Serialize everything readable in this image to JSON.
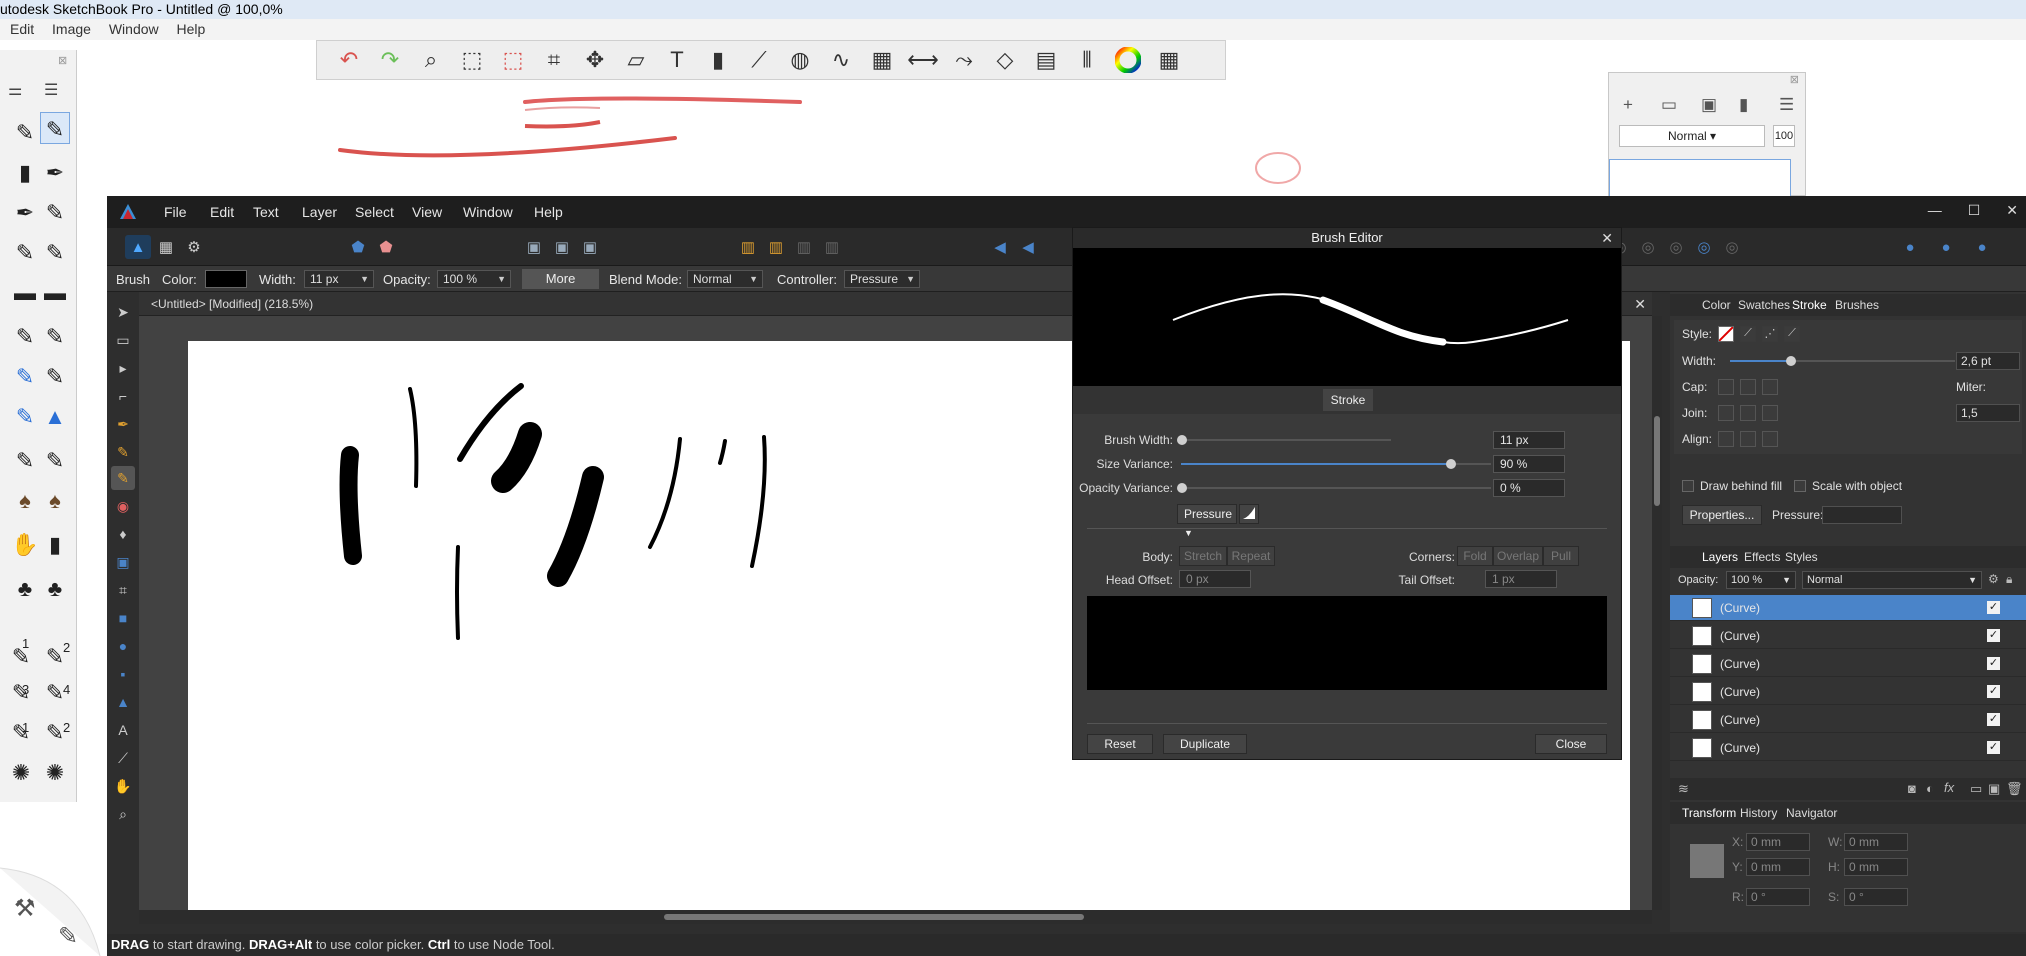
{
  "sketchbook": {
    "title": "utodesk SketchBook Pro - Untitled @ 100,0%",
    "menu": [
      "Edit",
      "Image",
      "Window",
      "Help"
    ],
    "toolbar_icons": [
      "undo-icon",
      "redo-icon",
      "zoom-icon",
      "select-icon",
      "lasso-icon",
      "crop-icon",
      "move-icon",
      "distort-icon",
      "text-icon",
      "bucket-icon",
      "ruler-icon",
      "ellipse-guide-icon",
      "curve-guide-icon",
      "perspective-icon",
      "symmetry-icon",
      "stroke-icon",
      "shapes-icon",
      "copic-icon",
      "brush-palette-icon",
      "color-wheel-icon",
      "palette-icon"
    ],
    "brush_numbers": [
      "1",
      "2",
      "3",
      "4",
      "1",
      "2"
    ],
    "layers": {
      "blend": "Normal",
      "opacity": "100"
    }
  },
  "affinity": {
    "menu": [
      "File",
      "Edit",
      "Text",
      "Layer",
      "Select",
      "View",
      "Window",
      "Help"
    ],
    "context_bar": {
      "tool": "Brush",
      "color_label": "Color:",
      "width_label": "Width:",
      "width_value": "11 px",
      "opacity_label": "Opacity:",
      "opacity_value": "100 %",
      "more_label": "More",
      "blend_label": "Blend Mode:",
      "blend_value": "Normal",
      "controller_label": "Controller:",
      "controller_value": "Pressure"
    },
    "document_tab": "<Untitled> [Modified] (218.5%)",
    "status": {
      "k1": "DRAG",
      "t1": " to start drawing. ",
      "k2": "DRAG+Alt",
      "t2": " to use color picker. ",
      "k3": "Ctrl",
      "t3": " to use Node Tool."
    },
    "stroke_panel": {
      "tabs": [
        "Color",
        "Swatches",
        "Stroke",
        "Brushes"
      ],
      "style_label": "Style:",
      "width_label": "Width:",
      "width_value": "2,6 pt",
      "cap_label": "Cap:",
      "join_label": "Join:",
      "miter_label": "Miter:",
      "miter_value": "1,5",
      "align_label": "Align:",
      "draw_behind": "Draw behind fill",
      "scale_with": "Scale with object",
      "properties_button": "Properties...",
      "pressure_label": "Pressure:"
    },
    "layers_panel": {
      "tabs": [
        "Layers",
        "Effects",
        "Styles"
      ],
      "opacity_label": "Opacity:",
      "opacity_value": "100 %",
      "blend_value": "Normal",
      "rows": [
        "(Curve)",
        "(Curve)",
        "(Curve)",
        "(Curve)",
        "(Curve)",
        "(Curve)"
      ]
    },
    "transform_panel": {
      "tabs": [
        "Transform",
        "History",
        "Navigator"
      ],
      "x_label": "X:",
      "x_value": "0 mm",
      "y_label": "Y:",
      "y_value": "0 mm",
      "w_label": "W:",
      "w_value": "0 mm",
      "h_label": "H:",
      "h_value": "0 mm",
      "r_label": "R:",
      "r_value": "0 °",
      "s_label": "S:",
      "s_value": "0 °"
    }
  },
  "brush_editor": {
    "title": "Brush Editor",
    "tab": "Stroke",
    "brush_width_label": "Brush Width:",
    "brush_width_value": "11 px",
    "brush_width_level": 0,
    "size_variance_label": "Size Variance:",
    "size_variance_value": "90 %",
    "size_variance_level": 0.9,
    "opacity_variance_label": "Opacity Variance:",
    "opacity_variance_value": "0 %",
    "opacity_variance_level": 0,
    "controller": "Pressure",
    "body_label": "Body:",
    "body_options": [
      "Stretch",
      "Repeat"
    ],
    "corners_label": "Corners:",
    "corners_options": [
      "Fold",
      "Overlap",
      "Pull"
    ],
    "head_offset_label": "Head Offset:",
    "head_offset_value": "0 px",
    "tail_offset_label": "Tail Offset:",
    "tail_offset_value": "1 px",
    "reset": "Reset",
    "duplicate": "Duplicate",
    "close": "Close"
  },
  "colors": {
    "accent": "#4a84c9",
    "sketch_red": "#d9534f",
    "brush_color": "#000000"
  }
}
